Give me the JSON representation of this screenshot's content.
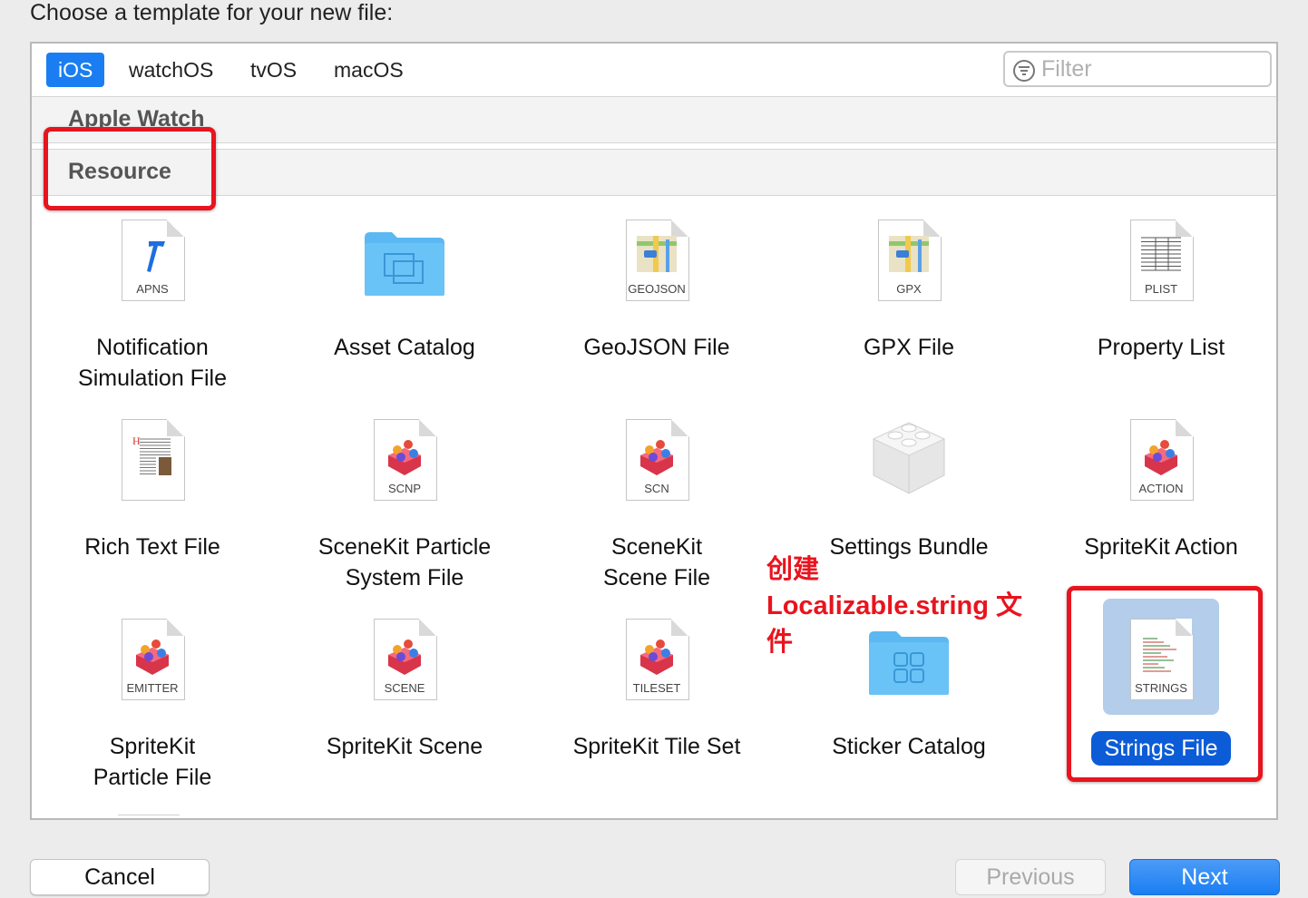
{
  "heading": "Choose a template for your new file:",
  "tabs": [
    "iOS",
    "watchOS",
    "tvOS",
    "macOS"
  ],
  "active_tab": "iOS",
  "filter": {
    "placeholder": "Filter",
    "value": ""
  },
  "sections": {
    "apple_watch": "Apple Watch",
    "resource": "Resource"
  },
  "items": [
    {
      "label": "Notification\nSimulation File",
      "icon_text": "APNS",
      "icon": "hammer-doc-icon"
    },
    {
      "label": "Asset Catalog",
      "icon_text": "",
      "icon": "folder-icon"
    },
    {
      "label": "GeoJSON File",
      "icon_text": "GEOJSON",
      "icon": "map-doc-icon"
    },
    {
      "label": "GPX File",
      "icon_text": "GPX",
      "icon": "map-doc-icon"
    },
    {
      "label": "Property List",
      "icon_text": "PLIST",
      "icon": "table-doc-icon"
    },
    {
      "label": "Rich Text File",
      "icon_text": "",
      "icon": "rich-text-doc-icon"
    },
    {
      "label": "SceneKit Particle\nSystem File",
      "icon_text": "SCNP",
      "icon": "scene-doc-icon"
    },
    {
      "label": "SceneKit\nScene File",
      "icon_text": "SCN",
      "icon": "scene-doc-icon"
    },
    {
      "label": "Settings Bundle",
      "icon_text": "",
      "icon": "lego-brick-icon"
    },
    {
      "label": "SpriteKit Action",
      "icon_text": "ACTION",
      "icon": "scene-doc-icon"
    },
    {
      "label": "SpriteKit\nParticle File",
      "icon_text": "EMITTER",
      "icon": "scene-doc-icon"
    },
    {
      "label": "SpriteKit Scene",
      "icon_text": "SCENE",
      "icon": "scene-doc-icon"
    },
    {
      "label": "SpriteKit Tile Set",
      "icon_text": "TILESET",
      "icon": "scene-doc-icon"
    },
    {
      "label": "Sticker Catalog",
      "icon_text": "",
      "icon": "sticker-folder-icon"
    },
    {
      "label": "Strings File",
      "icon_text": "STRINGS",
      "icon": "strings-doc-icon",
      "selected": true
    }
  ],
  "annotation": "创建\nLocalizable.string 文\n件",
  "buttons": {
    "cancel": "Cancel",
    "previous": "Previous",
    "next": "Next"
  },
  "colors": {
    "accent": "#1a7ef2",
    "selection": "#0b5cd6",
    "highlight": "#e8141e"
  }
}
